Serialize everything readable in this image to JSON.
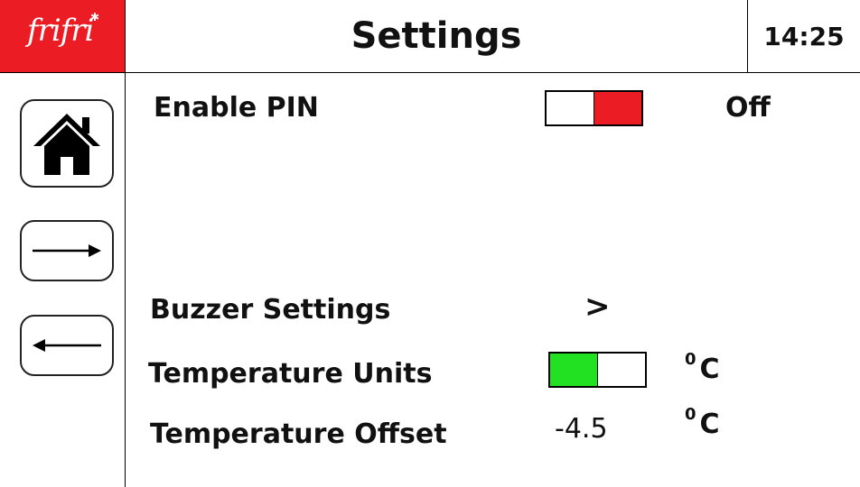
{
  "header": {
    "logo_text": "frifri",
    "title": "Settings",
    "time": "14:25"
  },
  "nav": [
    {
      "name": "home-icon"
    },
    {
      "name": "arrow-right-icon"
    },
    {
      "name": "arrow-left-icon"
    }
  ],
  "settings": {
    "enable_pin": {
      "label": "Enable PIN",
      "state": "Off",
      "on_color": "#ec1c24"
    },
    "buzzer": {
      "label": "Buzzer Settings",
      "chevron": ">"
    },
    "temp_units": {
      "label": "Temperature Units",
      "unit_sup": "0",
      "unit": "C",
      "on_color": "#22e022"
    },
    "temp_offset": {
      "label": "Temperature Offset",
      "value": "-4.5",
      "unit_sup": "0",
      "unit": "C"
    }
  },
  "colors": {
    "brand_red": "#ec1c24",
    "toggle_green": "#22e022"
  }
}
